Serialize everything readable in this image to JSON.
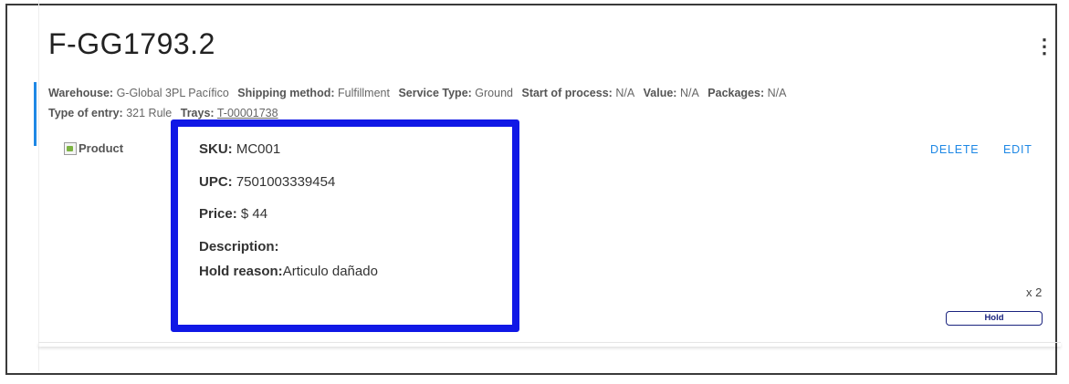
{
  "order": {
    "title": "F-GG1793.2",
    "more_icon": "⋮"
  },
  "meta": {
    "warehouse_label": "Warehouse:",
    "warehouse_value": "G-Global 3PL Pacífico",
    "shipping_label": "Shipping method:",
    "shipping_value": "Fulfillment",
    "service_label": "Service Type:",
    "service_value": "Ground",
    "start_label": "Start of process:",
    "start_value": "N/A",
    "value_label": "Value:",
    "value_value": "N/A",
    "packages_label": "Packages:",
    "packages_value": "N/A",
    "entry_label": "Type of entry:",
    "entry_value": "321 Rule",
    "trays_label": "Trays:",
    "trays_value": "T-00001738"
  },
  "product": {
    "image_alt": "Product",
    "sku_label": "SKU:",
    "sku_value": "MC001",
    "upc_label": "UPC:",
    "upc_value": "7501003339454",
    "price_label": "Price:",
    "price_value": "$ 44",
    "description_label": "Description:",
    "description_value": "",
    "hold_reason_label": "Hold reason:",
    "hold_reason_value": "Articulo dañado",
    "quantity": "x 2",
    "hold_button": "Hold"
  },
  "actions": {
    "delete": "DELETE",
    "edit": "EDIT"
  },
  "colors": {
    "accent": "#1e88e5",
    "highlight_border": "#1018e6",
    "hold_border": "#1a237e"
  }
}
